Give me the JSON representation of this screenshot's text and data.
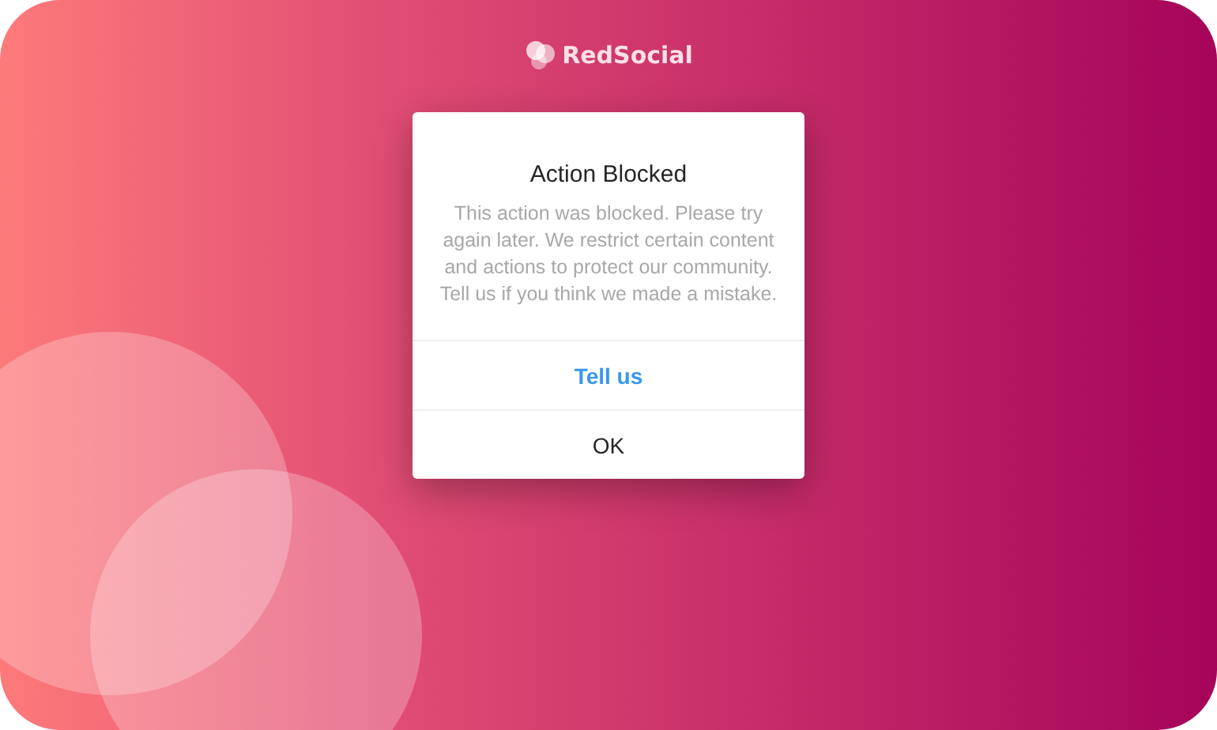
{
  "brand": {
    "name": "RedSocial"
  },
  "dialog": {
    "title": "Action Blocked",
    "message": "This action was blocked. Please try again later. We restrict certain content and actions to protect our community. Tell us if you think we made a mistake.",
    "buttons": [
      {
        "label": "Tell us",
        "kind": "link"
      },
      {
        "label": "OK",
        "kind": "plain"
      }
    ]
  }
}
